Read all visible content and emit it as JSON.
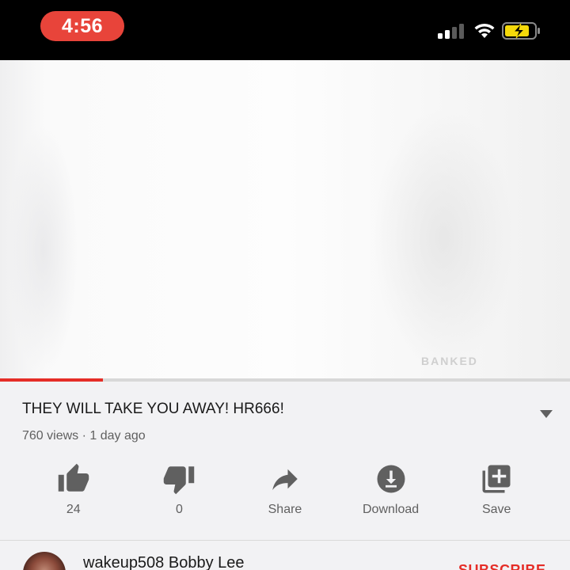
{
  "status_bar": {
    "time": "4:56",
    "icons": [
      "cellular-signal-icon",
      "wifi-icon",
      "battery-charging-icon"
    ],
    "colors": {
      "time_pill": "#e8443a",
      "battery_fill": "#f5d90a"
    }
  },
  "video": {
    "watermark": "BANKED",
    "progress_fraction": 0.18,
    "colors": {
      "progress": "#e52d27"
    }
  },
  "details": {
    "title": "THEY WILL TAKE YOU AWAY! HR666!",
    "meta": "760 views · 1 day ago"
  },
  "actions": [
    {
      "icon": "thumbs-up-icon",
      "label": "24"
    },
    {
      "icon": "thumbs-down-icon",
      "label": "0"
    },
    {
      "icon": "share-icon",
      "label": "Share"
    },
    {
      "icon": "download-icon",
      "label": "Download"
    },
    {
      "icon": "save-to-playlist-icon",
      "label": "Save"
    }
  ],
  "channel": {
    "name": "wakeup508 Bobby Lee",
    "subscribe_label": "SUBSCRIBE"
  }
}
